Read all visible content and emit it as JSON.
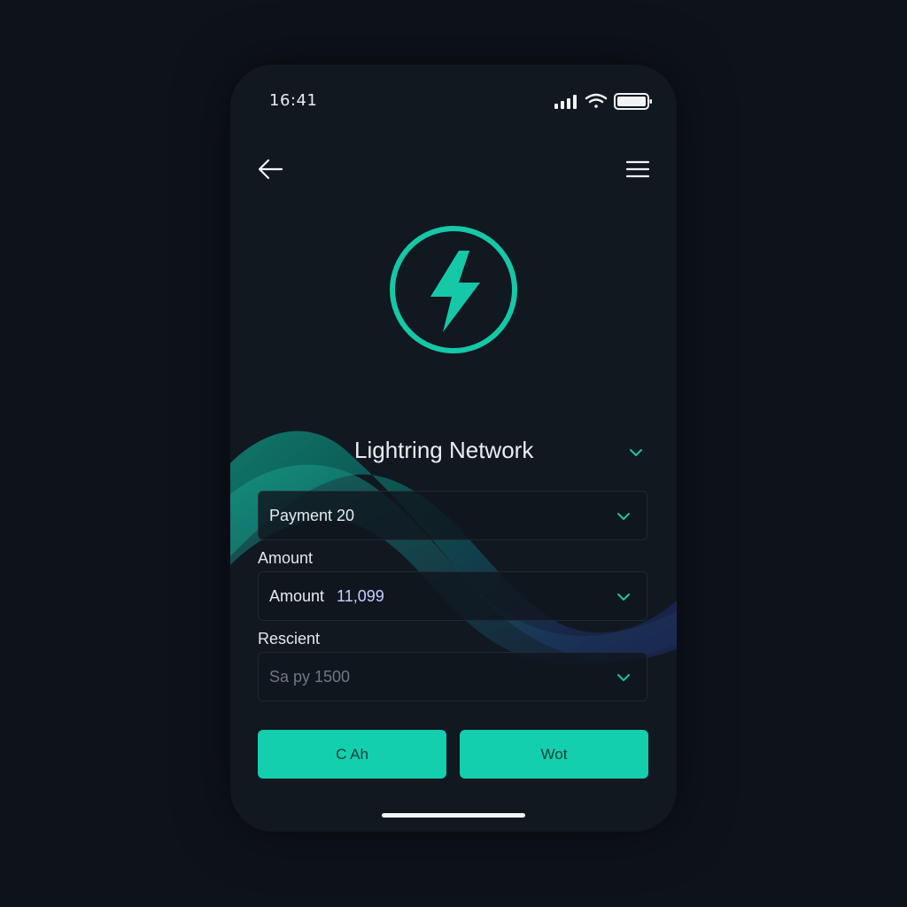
{
  "status": {
    "time": "16:41",
    "icons": [
      "signal-icon",
      "wifi-icon",
      "battery-icon"
    ]
  },
  "nav": {
    "back_icon": "arrow-left-icon",
    "menu_icon": "hamburger-menu-icon"
  },
  "hero": {
    "icon": "lightning-bolt-icon"
  },
  "network": {
    "title": "Lightring Network"
  },
  "form": {
    "payment_value": "Payment 20",
    "amount_label": "Amount",
    "amount_field_label": "Amount",
    "amount_value": "11,099",
    "recipient_label": "Rescient",
    "recipient_placeholder": "Sa py 1500"
  },
  "actions": {
    "left_label": "C Ah",
    "right_label": "Wot"
  },
  "colors": {
    "accent": "#13cfae",
    "background": "#0e131b",
    "panel": "#111820"
  }
}
